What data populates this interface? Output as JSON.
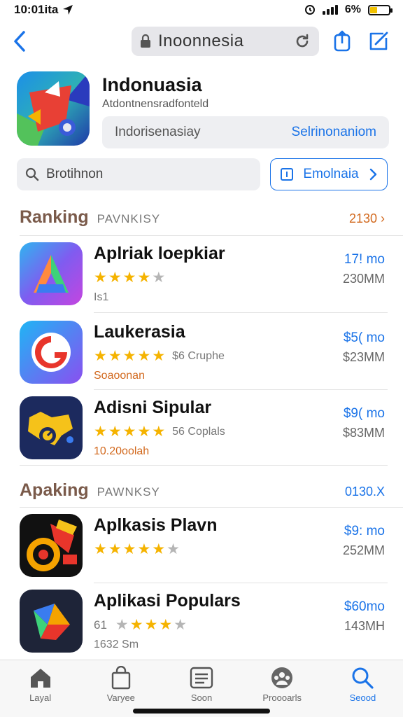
{
  "status_bar": {
    "time": "10:01ita",
    "battery": "6%"
  },
  "nav": {
    "url_text": "Inoonnesia"
  },
  "app_header": {
    "title": "Indonuasia",
    "subtitle": "Atdontnensradfonteld",
    "search_placeholder": "Indorisenasiay",
    "search_action": "Selrinonaniom"
  },
  "filter": {
    "input_text": "Brotihnon",
    "button_label": "Emolnaia"
  },
  "sections": [
    {
      "title": "Ranking",
      "sub": "PAVNKISY",
      "link": "2130 ›",
      "link_color": "#d2691e"
    },
    {
      "title": "Apaking",
      "sub": "PAWNKSY",
      "link": "0130.X",
      "link_color": "#1a73e8"
    }
  ],
  "apps": [
    {
      "name": "Aplriak loepkiar",
      "rating": 4,
      "meta": "",
      "prefix": "",
      "note": "Is1",
      "note_accent": false,
      "price": "17! mo",
      "size": "230MM"
    },
    {
      "name": "Laukerasia",
      "rating": 5,
      "meta": "$6 Cruphe",
      "prefix": "",
      "note": "Soaoonan",
      "note_accent": true,
      "price": "$5( mo",
      "size": "$23MM"
    },
    {
      "name": "Adisni Sipular",
      "rating": 5,
      "meta": "56 Coplals",
      "prefix": "",
      "note": "10.20oolah",
      "note_accent": true,
      "price": "$9( mo",
      "size": "$83MM"
    },
    {
      "name": "Aplkasis Plavn",
      "rating": 5,
      "meta": "",
      "prefix": "",
      "note": "",
      "note_accent": false,
      "price": "$9: mo",
      "size": "252MM"
    },
    {
      "name": "Aplikasi Populars",
      "rating": 3,
      "meta": "",
      "prefix": "61",
      "note": "1632 Sm",
      "note_accent": false,
      "price": "$60mo",
      "size": "143MH"
    }
  ],
  "tabs": [
    {
      "label": "Layal",
      "icon": "home-icon",
      "active": false
    },
    {
      "label": "Varyee",
      "icon": "bag-icon",
      "active": false
    },
    {
      "label": "Soon",
      "icon": "list-icon",
      "active": false
    },
    {
      "label": "Proooarls",
      "icon": "people-icon",
      "active": false
    },
    {
      "label": "Seood",
      "icon": "search-icon",
      "active": true
    }
  ],
  "colors": {
    "accent": "#1a73e8",
    "star": "#f5b300",
    "section_title": "#7a5a4a"
  }
}
